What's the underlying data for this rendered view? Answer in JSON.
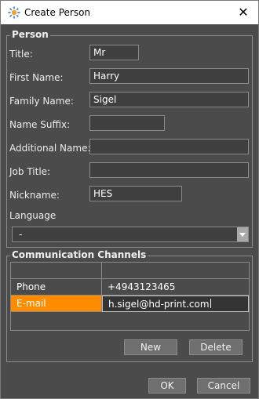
{
  "window": {
    "title": "Create Person",
    "close_glyph": "✕",
    "icon": "gear-sun-icon"
  },
  "person": {
    "legend": "Person",
    "title_label": "Title:",
    "title_value": "Mr",
    "first_name_label": "First Name:",
    "first_name_value": "Harry",
    "family_name_label": "Family Name:",
    "family_name_value": "Sigel",
    "name_suffix_label": "Name Suffix:",
    "name_suffix_value": "",
    "additional_name_label": "Additional Name:",
    "additional_name_value": "",
    "job_title_label": "Job Title:",
    "job_title_value": "",
    "nickname_label": "Nickname:",
    "nickname_value": "HES",
    "language_label": "Language",
    "language_value": "-"
  },
  "channels": {
    "legend": "Communication Channels",
    "rows": [
      {
        "type": "Phone",
        "value": "+4943123465"
      },
      {
        "type": "E-mail",
        "value": "h.sigel@hd-print.com"
      }
    ],
    "new_label": "New",
    "delete_label": "Delete"
  },
  "footer": {
    "ok_label": "OK",
    "cancel_label": "Cancel"
  },
  "colors": {
    "accent": "#ff8c00",
    "background": "#4b4b4b"
  }
}
